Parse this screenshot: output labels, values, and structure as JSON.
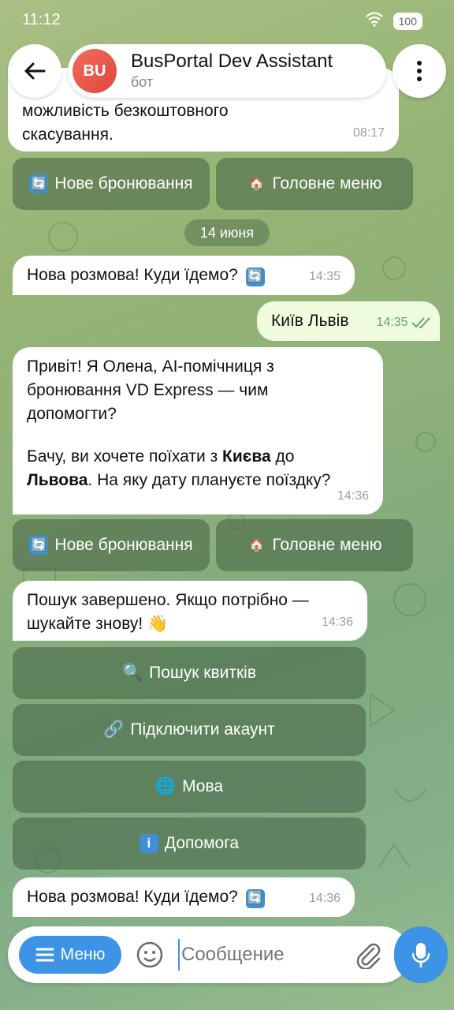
{
  "status": {
    "time": "11:12",
    "battery": "100"
  },
  "header": {
    "avatar_initials": "BU",
    "title": "BusPortal Dev Assistant",
    "subtitle": "бот"
  },
  "messages": {
    "m0": {
      "partial_text": "можливість безкоштовного скасування.",
      "time": "08:17"
    },
    "m1": {
      "text": "Нова розмова! Куди їдемо?",
      "time": "14:35"
    },
    "m2": {
      "text": "Київ Львів",
      "time": "14:35"
    },
    "m3": {
      "line1": "Привіт! Я Олена, AI-помічниця з",
      "line2": "бронювання VD Express — чим",
      "line3": "допомогти?",
      "p2a": "Бачу, ви хочете поїхати з ",
      "city1": "Києва",
      "p2b": " до",
      "city2": "Львова",
      "p2c": ". На яку дату плануєте поїздку?",
      "time": "14:36"
    },
    "m4": {
      "line1": "Пошук завершено. Якщо потрібно —",
      "line2": "шукайте знову!",
      "emoji": "👋",
      "time": "14:36"
    },
    "m5": {
      "text": "Нова розмова! Куди їдемо?",
      "time": "14:36"
    }
  },
  "date_separator": "14 июня",
  "inline_buttons": {
    "new_booking": "Нове бронювання",
    "main_menu": "Головне меню",
    "search_tickets": "Пошук квитків",
    "connect_account": "Підключити акаунт",
    "language": "Мова",
    "help": "Допомога"
  },
  "input": {
    "menu_label": "Меню",
    "placeholder": "Сообщение"
  },
  "colors": {
    "accent": "#3d93e6",
    "outgoing_bubble": "#effdde",
    "avatar": "#e0453d"
  }
}
